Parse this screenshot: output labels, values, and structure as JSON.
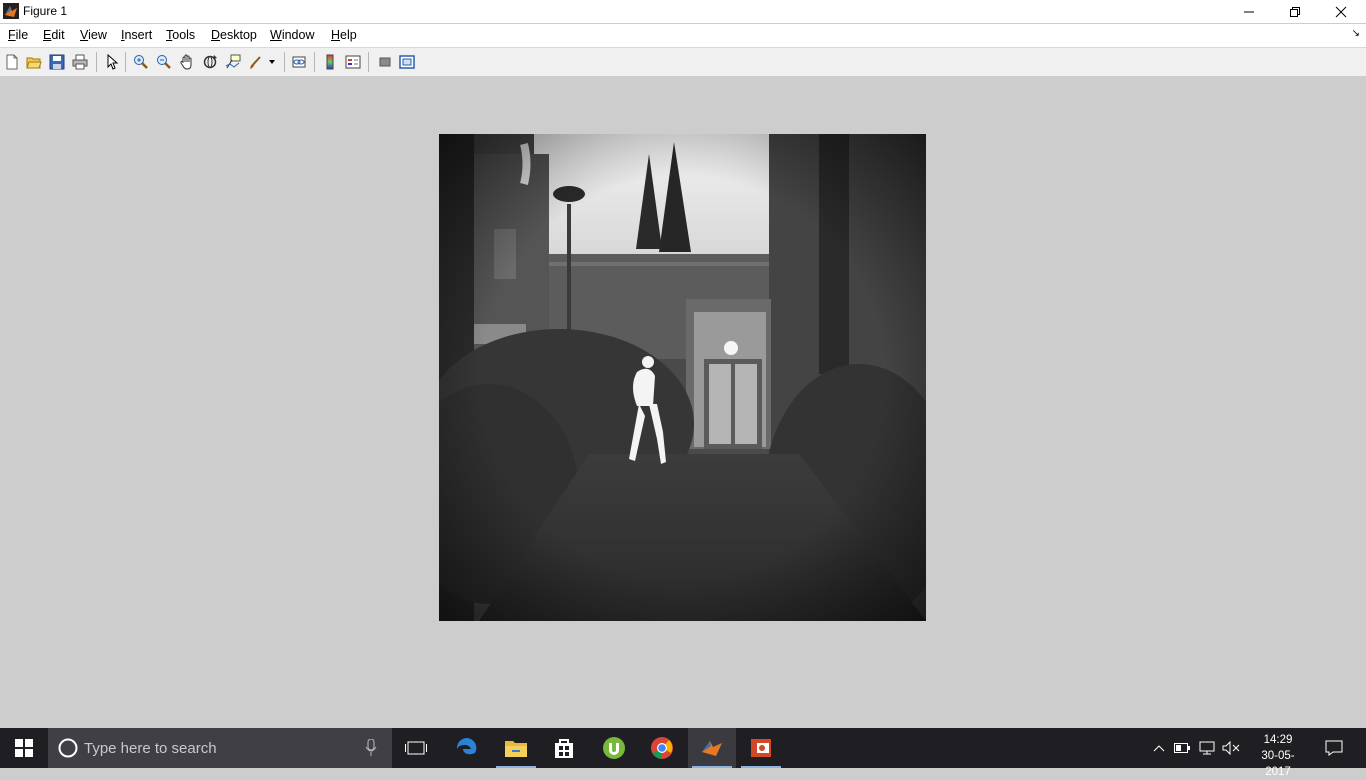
{
  "window": {
    "title": "Figure 1",
    "controls": [
      "minimize",
      "restore",
      "close"
    ]
  },
  "menu": {
    "items": [
      {
        "label": "File",
        "mnemonic": "F"
      },
      {
        "label": "Edit",
        "mnemonic": "E"
      },
      {
        "label": "View",
        "mnemonic": "V"
      },
      {
        "label": "Insert",
        "mnemonic": "I"
      },
      {
        "label": "Tools",
        "mnemonic": "T"
      },
      {
        "label": "Desktop",
        "mnemonic": "D"
      },
      {
        "label": "Window",
        "mnemonic": "W"
      },
      {
        "label": "Help",
        "mnemonic": "H"
      }
    ]
  },
  "toolbar": {
    "buttons": [
      "new-figure-icon",
      "open-file-icon",
      "save-icon",
      "print-icon",
      "edit-plot-icon",
      "zoom-in-icon",
      "zoom-out-icon",
      "pan-icon",
      "rotate-3d-icon",
      "data-cursor-icon",
      "brush-icon",
      "link-plot-icon",
      "insert-colorbar-icon",
      "insert-legend-icon",
      "hide-plot-tools-icon",
      "show-plot-tools-icon"
    ]
  },
  "figure": {
    "image_description": "grayscale thermal image"
  },
  "taskbar": {
    "search_placeholder": "Type here to search",
    "clock_time": "14:29",
    "clock_date": "30-05-2017",
    "apps": [
      "task-view-icon",
      "edge-icon",
      "file-explorer-icon",
      "store-icon",
      "utorrent-icon",
      "chrome-icon",
      "matlab-icon",
      "powerpoint-icon"
    ]
  },
  "colors": {
    "figure_bg": "#cdcdcd",
    "taskbar_bg": "#1f1f23",
    "search_bg": "#3f3f45"
  }
}
